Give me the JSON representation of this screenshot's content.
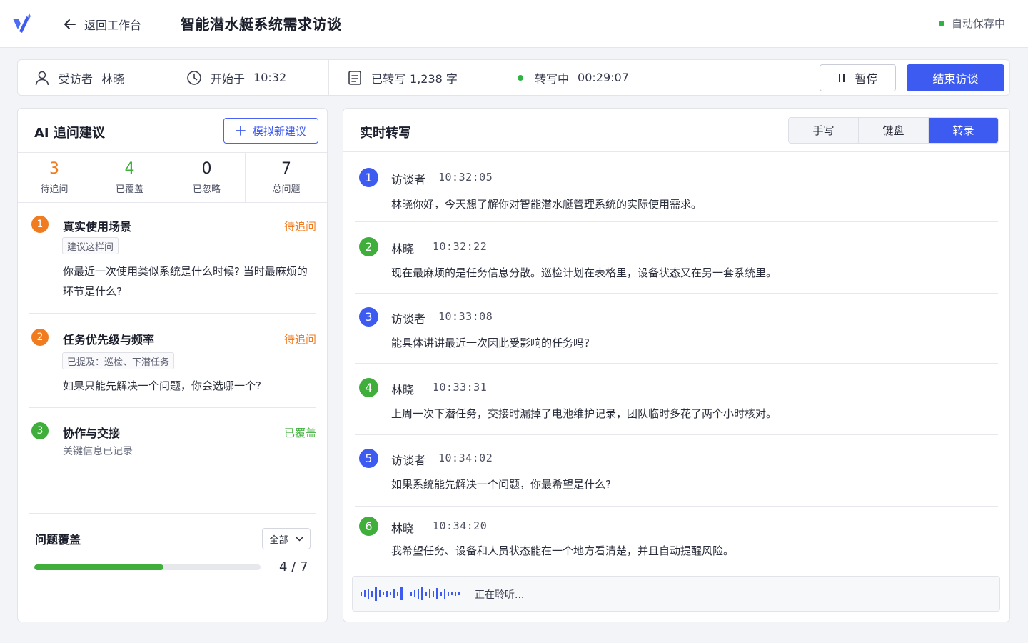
{
  "header": {
    "back_label": "返回工作台",
    "title": "智能潜水艇系统需求访谈",
    "autosave_label": "自动保存中"
  },
  "status_bar": {
    "interviewee_label": "受访者",
    "interviewee_name": "林晓",
    "start_label": "开始于",
    "start_time": "10:32",
    "transcribed_label": "已转写",
    "transcribed_count": "1,238 字",
    "recording_label": "转写中",
    "elapsed": "00:29:07",
    "pause_label": "暂停",
    "end_label": "结束访谈"
  },
  "ai_panel": {
    "title": "AI 追问建议",
    "simulate_label": "模拟新建议",
    "counts": [
      {
        "value": "3",
        "label": "待追问",
        "color": "#f07c1f"
      },
      {
        "value": "4",
        "label": "已覆盖",
        "color": "#3fae3b"
      },
      {
        "value": "0",
        "label": "已忽略",
        "color": "#1f2230"
      },
      {
        "value": "7",
        "label": "总问题",
        "color": "#1f2230"
      }
    ],
    "suggestions": [
      {
        "num": "1",
        "title": "真实使用场景",
        "status": "待追问",
        "tag": "建议这样问",
        "question": "你最近一次使用类似系统是什么时候? 当时最麻烦的环节是什么?"
      },
      {
        "num": "2",
        "title": "任务优先级与频率",
        "status": "待追问",
        "tag": "已提及：巡检、下潜任务",
        "question": "如果只能先解决一个问题，你会选哪一个?"
      },
      {
        "num": "3",
        "title": "协作与交接",
        "status": "已覆盖",
        "note": "关键信息已记录"
      }
    ],
    "coverage": {
      "title": "问题覆盖",
      "filter": "全部",
      "progress": 0.57,
      "progress_text": "4 / 7"
    }
  },
  "transcript": {
    "title": "实时转写",
    "tabs": [
      "手写",
      "键盘",
      "转录"
    ],
    "active_tab": "转录",
    "messages": [
      {
        "num": "1",
        "speaker": "访谈者",
        "time": "10:32:05",
        "text": "林晓你好，今天想了解你对智能潜水艇管理系统的实际使用需求。"
      },
      {
        "num": "2",
        "speaker": "林晓",
        "time": "10:32:22",
        "text": "现在最麻烦的是任务信息分散。巡检计划在表格里，设备状态又在另一套系统里。"
      },
      {
        "num": "3",
        "speaker": "访谈者",
        "time": "10:33:08",
        "text": "能具体讲讲最近一次因此受影响的任务吗?"
      },
      {
        "num": "4",
        "speaker": "林晓",
        "time": "10:33:31",
        "text": "上周一次下潜任务，交接时漏掉了电池维护记录，团队临时多花了两个小时核对。"
      },
      {
        "num": "5",
        "speaker": "访谈者",
        "time": "10:34:02",
        "text": "如果系统能先解决一个问题，你最希望是什么?"
      },
      {
        "num": "6",
        "speaker": "林晓",
        "time": "10:34:20",
        "text": "我希望任务、设备和人员状态能在一个地方看清楚，并且自动提醒风险。"
      }
    ],
    "listening_label": "正在聆听..."
  },
  "colors": {
    "accent": "#3d5af1",
    "interviewer": "#3d5af1",
    "interviewee": "#3fae3b",
    "pending": "#f07c1f",
    "covered": "#3fae3b"
  }
}
